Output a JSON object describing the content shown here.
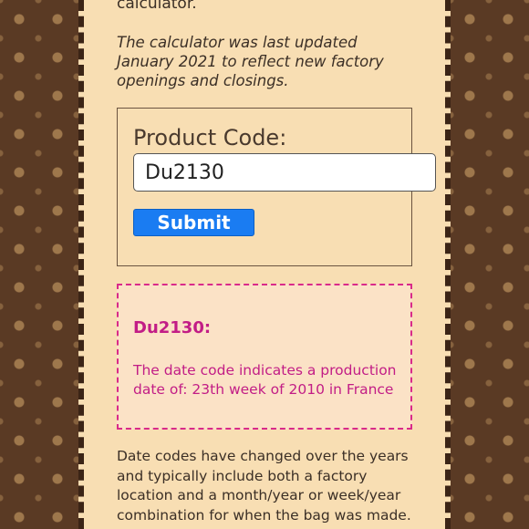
{
  "intro": {
    "tail_text": "calculator."
  },
  "update_note": "The calculator was last updated January 2021 to reflect new factory openings and closings.",
  "form": {
    "label": "Product Code:",
    "input_value": "Du2130",
    "submit_label": "Submit"
  },
  "result": {
    "code": "Du2130:",
    "message": "The date code indicates a production date of: 23th week of 2010 in France"
  },
  "footer": {
    "text": "Date codes have changed over the years and typically include both a factory location and a month/year or week/year combination for when the bag was made."
  },
  "colors": {
    "panel_bg": "#f8deb3",
    "border_brown": "#5a3a24",
    "submit_blue": "#1a7cf2",
    "result_pink": "#c21d86",
    "result_border": "#d92a8a"
  }
}
